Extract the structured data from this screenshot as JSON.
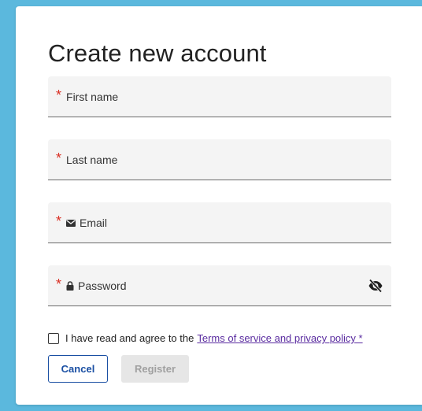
{
  "form": {
    "title": "Create new account",
    "required_marker": "*",
    "fields": [
      {
        "id": "first-name",
        "label": "First name",
        "icon": null
      },
      {
        "id": "last-name",
        "label": "Last name",
        "icon": null
      },
      {
        "id": "email",
        "label": "Email",
        "icon": "envelope-icon"
      },
      {
        "id": "password",
        "label": "Password",
        "icon": "lock-icon",
        "toggle_icon": "eye-slash-icon"
      }
    ],
    "agreement": {
      "text": "I have read and agree to the",
      "link": "Terms of service and privacy policy *",
      "checked": false
    },
    "buttons": {
      "cancel": "Cancel",
      "register": "Register"
    }
  },
  "colors": {
    "background": "#5bb8dd",
    "required": "#d93025",
    "link": "#5a2ca0",
    "primary": "#1a4fa3"
  }
}
